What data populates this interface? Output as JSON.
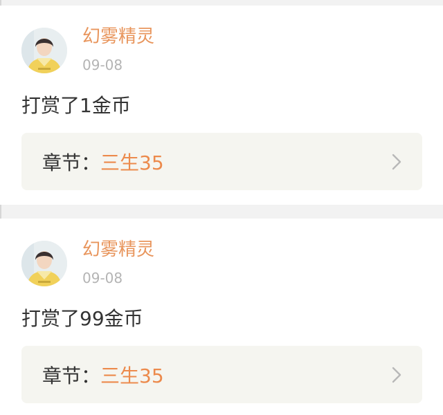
{
  "feed": {
    "items": [
      {
        "username": "幻雾精灵",
        "date": "09-08",
        "message": "打赏了1金币",
        "chapter_prefix": "章节：",
        "chapter_name": "三生35"
      },
      {
        "username": "幻雾精灵",
        "date": "09-08",
        "message": "打赏了99金币",
        "chapter_prefix": "章节：",
        "chapter_name": "三生35"
      }
    ]
  },
  "colors": {
    "username": "#e8955c",
    "chapter_accent": "#ec8a4c",
    "date": "#b4b4b4",
    "card_bg": "#ffffff",
    "page_bg": "#f2f2f2",
    "chapter_bg": "#f5f5f0"
  },
  "icons": {
    "chevron": "chevron-right-icon",
    "avatar": "user-avatar"
  }
}
